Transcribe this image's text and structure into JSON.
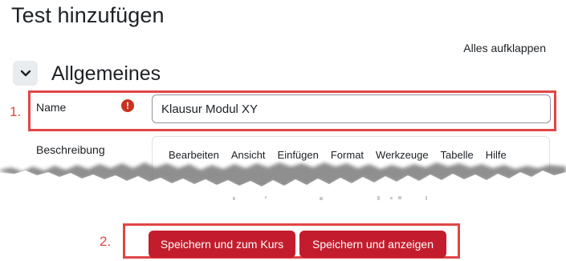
{
  "page": {
    "title": "Test hinzufügen"
  },
  "expand_all": "Alles aufklappen",
  "section": {
    "title": "Allgemeines"
  },
  "annotations": {
    "one": "1.",
    "two": "2."
  },
  "name_field": {
    "label": "Name",
    "value": "Klausur Modul XY",
    "required_icon": "exclamation-circle-icon"
  },
  "description_field": {
    "label": "Beschreibung",
    "menu": [
      "Bearbeiten",
      "Ansicht",
      "Einfügen",
      "Format",
      "Werkzeuge",
      "Tabelle",
      "Hilfe"
    ]
  },
  "buttons": {
    "save_return": "Speichern und zum Kurs",
    "save_display": "Speichern und anzeigen"
  },
  "colors": {
    "annotation": "#e04646",
    "primary": "#c31d2d",
    "required": "#ca3120"
  }
}
